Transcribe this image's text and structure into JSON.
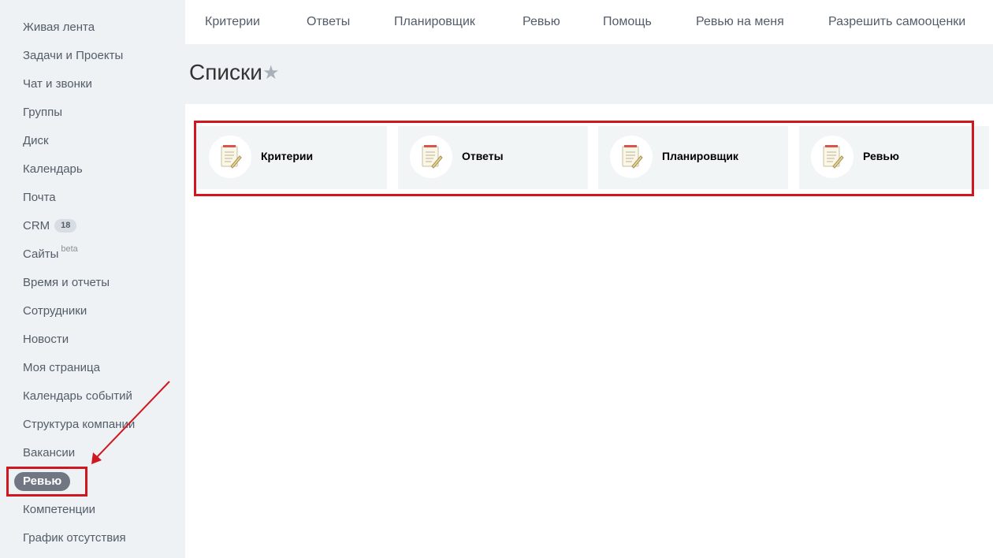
{
  "sidebar": {
    "items": [
      {
        "label": "Живая лента"
      },
      {
        "label": "Задачи и Проекты"
      },
      {
        "label": "Чат и звонки"
      },
      {
        "label": "Группы"
      },
      {
        "label": "Диск"
      },
      {
        "label": "Календарь"
      },
      {
        "label": "Почта"
      },
      {
        "label": "CRM",
        "badge": "18"
      },
      {
        "label": "Сайты",
        "sup": "beta"
      },
      {
        "label": "Время и отчеты"
      },
      {
        "label": "Сотрудники"
      },
      {
        "label": "Новости"
      },
      {
        "label": "Моя страница"
      },
      {
        "label": "Календарь событий"
      },
      {
        "label": "Структура компании"
      },
      {
        "label": "Вакансии"
      },
      {
        "label": "Ревью",
        "active": true
      },
      {
        "label": "Компетенции"
      },
      {
        "label": "График отсутствия"
      }
    ]
  },
  "topnav": {
    "items": [
      "Критерии",
      "Ответы",
      "Планировщик",
      "Ревью",
      "Помощь",
      "Ревью на меня",
      "Разрешить самооценки"
    ]
  },
  "page": {
    "title": "Списки",
    "star_icon": "star-icon"
  },
  "cards": [
    {
      "label": "Критерии",
      "icon": "list-document-icon"
    },
    {
      "label": "Ответы",
      "icon": "list-document-icon"
    },
    {
      "label": "Планировщик",
      "icon": "list-document-icon"
    },
    {
      "label": "Ревью",
      "icon": "list-document-icon"
    }
  ],
  "colors": {
    "sidebar_bg": "#eef2f4",
    "active_pill": "#707782",
    "annotation_red": "#d0161f",
    "card_bg": "#f1f5f6"
  }
}
